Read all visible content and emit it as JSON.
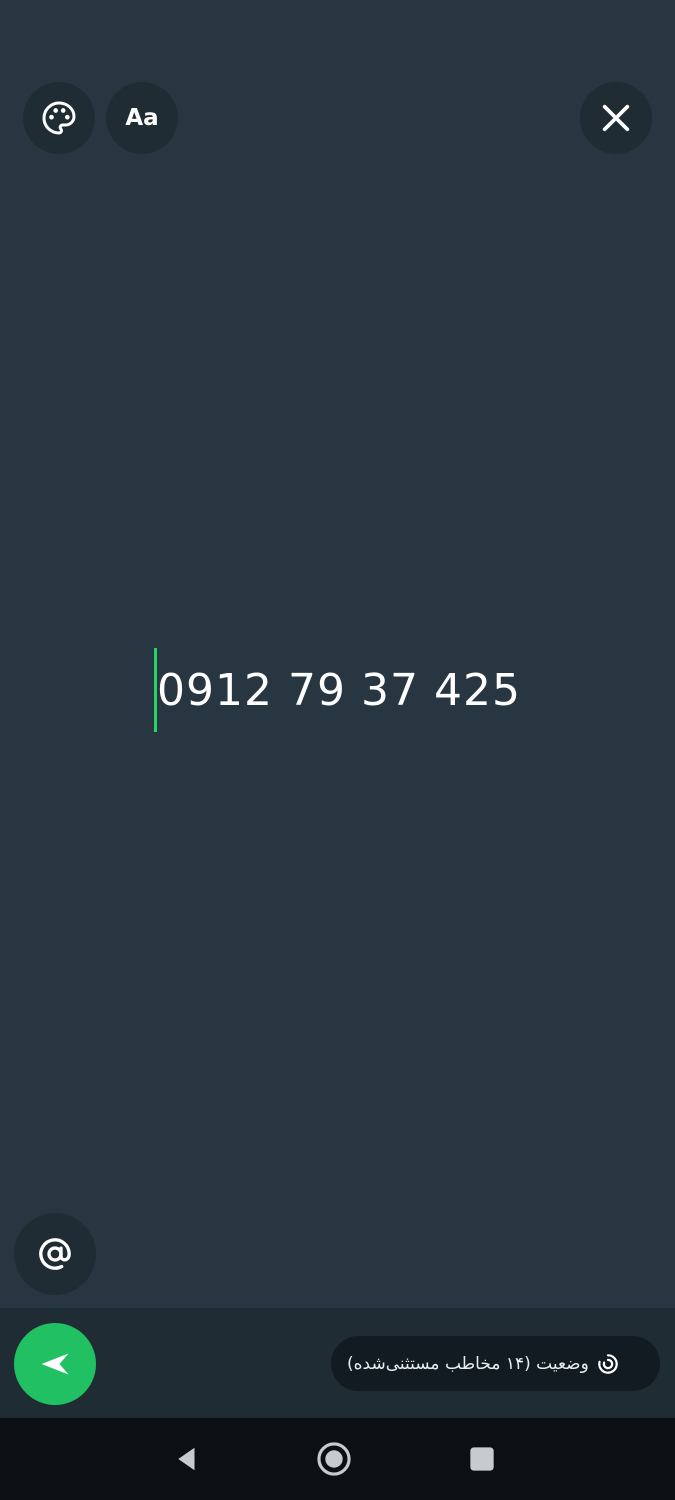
{
  "toolbar": {
    "palette_icon": "palette-icon",
    "font_label": "Aa",
    "close_icon": "close-icon"
  },
  "editor": {
    "text": "0912 79 37 425",
    "caret_color": "#25d366"
  },
  "mention": {
    "icon": "at-sign-icon"
  },
  "composer": {
    "send_icon": "send-arrow-icon",
    "send_color": "#21c063",
    "privacy_icon": "status-ring-icon",
    "privacy_label": "وضعیت (۱۴ مخاطب مستثنی‌شده)"
  },
  "colors": {
    "background": "#273640",
    "button_bg": "#1f2c33",
    "pill_bg": "#111b21",
    "nav_bg": "#0b1014"
  },
  "navigation": {
    "back_icon": "nav-back-icon",
    "home_icon": "nav-home-icon",
    "recents_icon": "nav-recents-icon"
  }
}
